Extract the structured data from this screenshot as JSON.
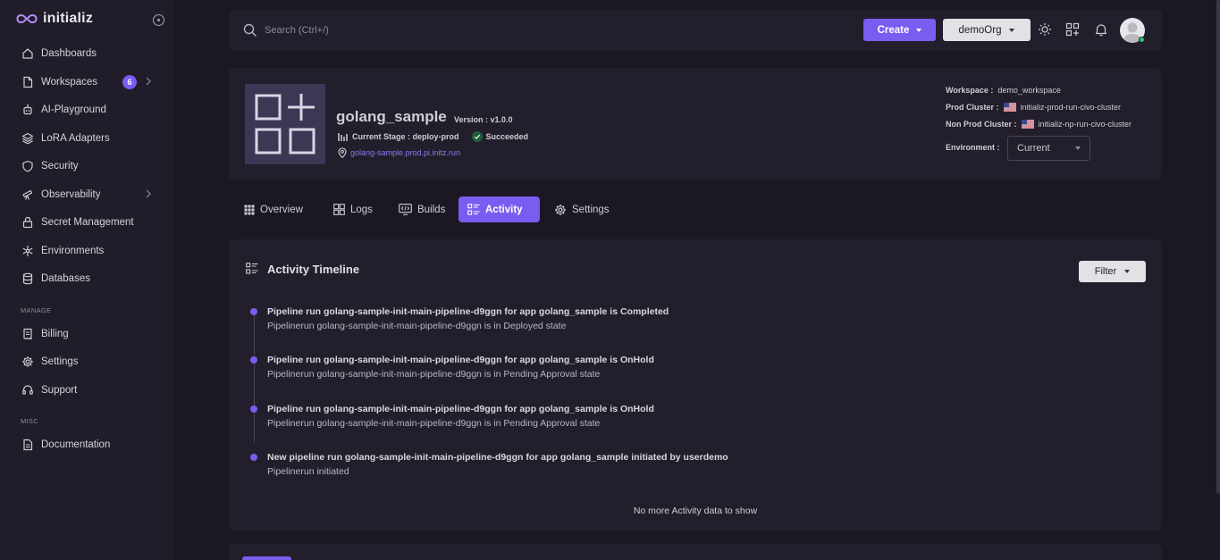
{
  "brand": {
    "name": "initializ"
  },
  "sidebar": {
    "items": [
      {
        "label": "Dashboards",
        "icon": "home-icon"
      },
      {
        "label": "Workspaces",
        "icon": "file-icon",
        "badge": "6"
      },
      {
        "label": "AI-Playground",
        "icon": "robot-icon"
      },
      {
        "label": "LoRA Adapters",
        "icon": "layers-icon"
      },
      {
        "label": "Security",
        "icon": "shield-icon"
      },
      {
        "label": "Observability",
        "icon": "telescope-icon"
      },
      {
        "label": "Secret Management",
        "icon": "lock-icon"
      },
      {
        "label": "Environments",
        "icon": "snowflake-icon"
      },
      {
        "label": "Databases",
        "icon": "database-icon"
      }
    ],
    "manage_label": "MANAGE",
    "manage": [
      {
        "label": "Billing",
        "icon": "receipt-icon"
      },
      {
        "label": "Settings",
        "icon": "gear-icon"
      },
      {
        "label": "Support",
        "icon": "headset-icon"
      }
    ],
    "misc_label": "MISC",
    "misc": [
      {
        "label": "Documentation",
        "icon": "document-icon"
      }
    ]
  },
  "topbar": {
    "search_placeholder": "Search (Ctrl+/)",
    "create_label": "Create",
    "org_label": "demoOrg"
  },
  "app": {
    "name": "golang_sample",
    "version": "Version : v1.0.0",
    "stage": "Current Stage : deploy-prod",
    "status": "Succeeded",
    "url": "golang-sample.prod.pi.initz.run",
    "workspace_label": "Workspace :",
    "workspace": "demo_workspace",
    "prod_cluster_label": "Prod Cluster :",
    "prod_cluster": "initializ-prod-run-civo-cluster",
    "nonprod_cluster_label": "Non Prod Cluster :",
    "nonprod_cluster": "initializ-np-run-civo-cluster",
    "environment_label": "Environment :",
    "environment": "Current"
  },
  "tabs": [
    {
      "label": "Overview"
    },
    {
      "label": "Logs"
    },
    {
      "label": "Builds"
    },
    {
      "label": "Activity",
      "active": true
    },
    {
      "label": "Settings"
    }
  ],
  "activity": {
    "title": "Activity Timeline",
    "filter_label": "Filter",
    "items": [
      {
        "title": "Pipeline run golang-sample-init-main-pipeline-d9ggn for app golang_sample is Completed",
        "sub": "Pipelinerun golang-sample-init-main-pipeline-d9ggn is in Deployed state"
      },
      {
        "title": "Pipeline run golang-sample-init-main-pipeline-d9ggn for app golang_sample is OnHold",
        "sub": "Pipelinerun golang-sample-init-main-pipeline-d9ggn is in Pending Approval state"
      },
      {
        "title": "Pipeline run golang-sample-init-main-pipeline-d9ggn for app golang_sample is OnHold",
        "sub": "Pipelinerun golang-sample-init-main-pipeline-d9ggn is in Pending Approval state"
      },
      {
        "title": "New pipeline run golang-sample-init-main-pipeline-d9ggn for app golang_sample initiated by userdemo",
        "sub": "Pipelinerun initiated"
      }
    ],
    "no_more": "No more Activity data to show"
  },
  "colors": {
    "accent": "#7b5cf0",
    "success": "#28c76f",
    "background": "#1b1823",
    "card": "#221e2b"
  }
}
